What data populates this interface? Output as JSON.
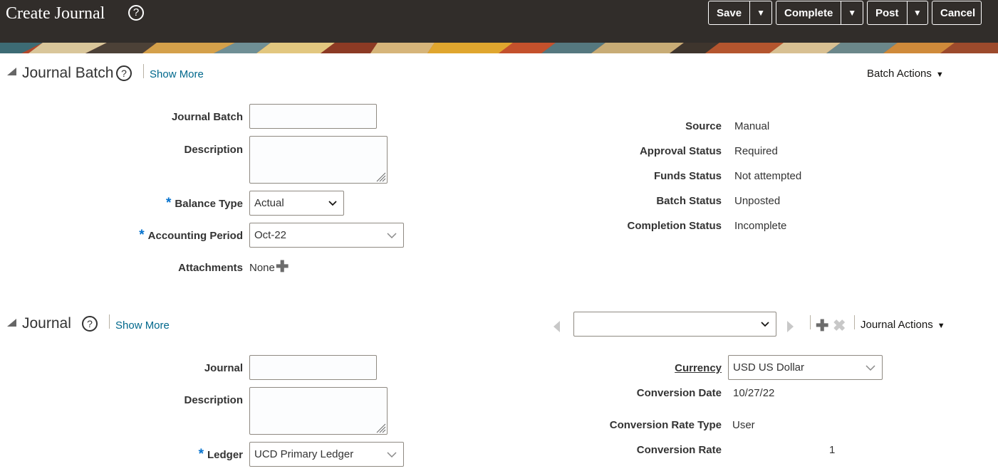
{
  "header": {
    "title": "Create Journal",
    "help_icon": "help-circle-icon",
    "buttons": {
      "save": "Save",
      "complete": "Complete",
      "post": "Post",
      "cancel": "Cancel"
    }
  },
  "batch": {
    "title": "Journal Batch",
    "show_more": "Show More",
    "actions": "Batch Actions",
    "fields": {
      "journal_batch_label": "Journal Batch",
      "journal_batch_value": "",
      "description_label": "Description",
      "description_value": "",
      "balance_type_label": "Balance Type",
      "balance_type_value": "Actual",
      "accounting_period_label": "Accounting Period",
      "accounting_period_value": "Oct-22",
      "attachments_label": "Attachments",
      "attachments_value": "None"
    },
    "status": {
      "source_label": "Source",
      "source_value": "Manual",
      "approval_label": "Approval Status",
      "approval_value": "Required",
      "funds_label": "Funds Status",
      "funds_value": "Not attempted",
      "batch_status_label": "Batch Status",
      "batch_status_value": "Unposted",
      "completion_label": "Completion Status",
      "completion_value": "Incomplete"
    }
  },
  "journal": {
    "title": "Journal",
    "show_more": "Show More",
    "actions": "Journal Actions",
    "selector_value": "",
    "fields": {
      "journal_label": "Journal",
      "journal_value": "",
      "description_label": "Description",
      "description_value": "",
      "ledger_label": "Ledger",
      "ledger_value": "UCD Primary Ledger"
    },
    "currency": {
      "currency_label": "Currency",
      "currency_value": "USD US Dollar",
      "conversion_date_label": "Conversion Date",
      "conversion_date_value": "10/27/22",
      "rate_type_label": "Conversion Rate Type",
      "rate_type_value": "User",
      "rate_label": "Conversion Rate",
      "rate_value": "1"
    }
  },
  "colors": {
    "header_bg": "#312d2a",
    "link": "#00688c",
    "required": "#0572ce"
  }
}
